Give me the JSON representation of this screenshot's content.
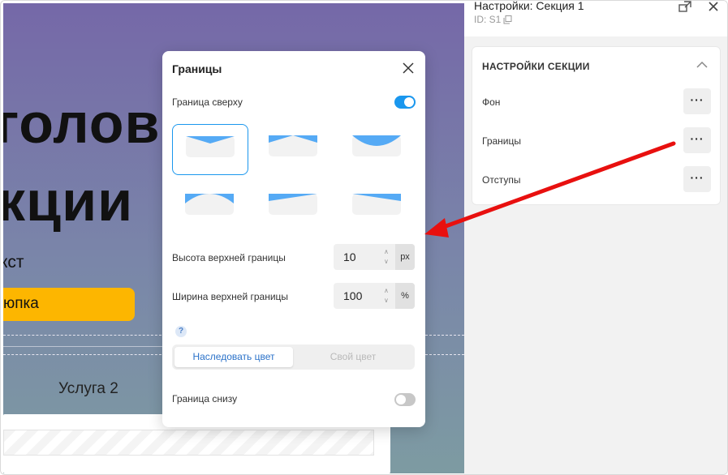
{
  "canvas": {
    "title_line1": "голов",
    "title_line2": "кции",
    "text": "кст",
    "button_label": "юпка",
    "service_label": "Услуга 2"
  },
  "panel": {
    "title": "Настройки: Секция 1",
    "id": "ID: S1",
    "section_heading": "НАСТРОЙКИ СЕКЦИИ",
    "items": [
      {
        "label": "Фон",
        "more": "···"
      },
      {
        "label": "Границы",
        "more": "···"
      },
      {
        "label": "Отступы",
        "more": "···"
      }
    ]
  },
  "dialog": {
    "title": "Границы",
    "top_border_label": "Граница сверху",
    "top_border_enabled": true,
    "top_height_label": "Высота верхней границы",
    "top_height_value": "10",
    "top_height_unit": "px",
    "top_width_label": "Ширина верхней границы",
    "top_width_value": "100",
    "top_width_unit": "%",
    "help": "?",
    "color_mode": {
      "inherit": "Наследовать цвет",
      "custom": "Свой цвет"
    },
    "bottom_border_label": "Граница снизу",
    "bottom_border_enabled": false
  },
  "colors": {
    "accent": "#1a97ee",
    "shape_fill": "#55aaf5",
    "arrow": "#e8100f",
    "button_yellow": "#fdb600"
  },
  "icons": {
    "dialog_close": "close-icon",
    "panel_close": "close-icon",
    "popout": "popout-icon",
    "copy": "copy-icon",
    "collapse": "chevron-up-icon"
  }
}
